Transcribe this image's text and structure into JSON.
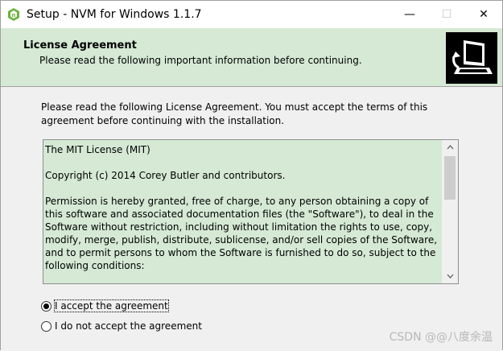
{
  "window": {
    "title": "Setup - NVM for Windows 1.1.7",
    "minimize_symbol": "—",
    "maximize_symbol": "☐",
    "close_symbol": "✕"
  },
  "header": {
    "title": "License Agreement",
    "subtitle": "Please read the following important information before continuing."
  },
  "intro": "Please read the following License Agreement. You must accept the terms of this agreement before continuing with the installation.",
  "license": {
    "line1": "The MIT License (MIT)",
    "line2": "Copyright (c) 2014 Corey Butler and contributors.",
    "line3": "Permission is hereby granted, free of charge, to any person obtaining a copy of this software and associated documentation files (the \"Software\"), to deal in the Software without restriction, including without limitation the rights to use, copy, modify, merge, publish, distribute, sublicense, and/or sell copies of the Software, and to permit persons to whom the Software is furnished to do so, subject to the following conditions:"
  },
  "options": {
    "accept": "I accept the agreement",
    "decline": "I do not accept the agreement",
    "selected": "accept"
  },
  "watermark": "CSDN @@八度余温",
  "colors": {
    "header_bg": "#d5e9d5",
    "license_bg": "#d5e9d5"
  },
  "icons": {
    "app": "nvm-app-icon",
    "header": "setup-computer-icon"
  }
}
